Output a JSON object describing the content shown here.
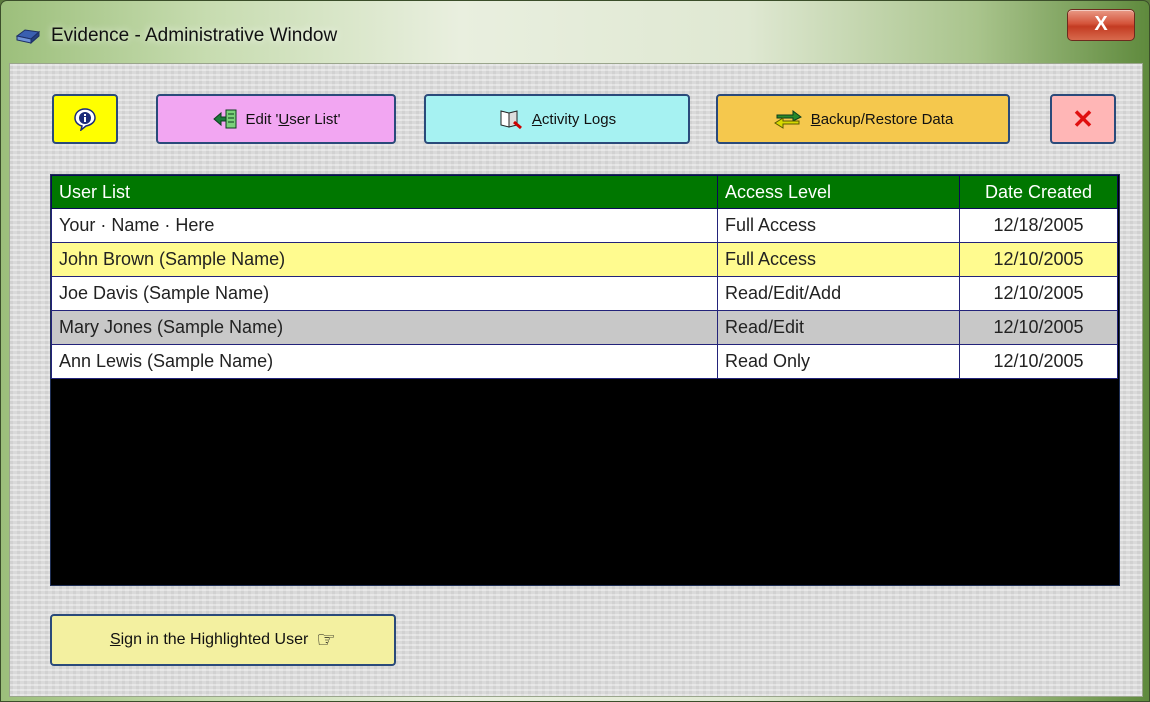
{
  "window": {
    "title": "Evidence - Administrative Window",
    "close_glyph": "X"
  },
  "toolbar": {
    "info_icon": "info-icon",
    "edit_label_pre": "Edit '",
    "edit_label_u": "U",
    "edit_label_post": "ser List'",
    "logs_label_u": "A",
    "logs_label_post": "ctivity Logs",
    "backup_label_u": "B",
    "backup_label_post": "ackup/Restore Data",
    "close_glyph": "✕"
  },
  "grid": {
    "headers": [
      "User List",
      "Access Level",
      "Date Created"
    ],
    "rows": [
      {
        "name": "Your · Name · Here",
        "access": "Full Access",
        "date": "12/18/2005"
      },
      {
        "name": "John Brown (Sample Name)",
        "access": "Full Access",
        "date": "12/10/2005"
      },
      {
        "name": "Joe Davis (Sample Name)",
        "access": "Read/Edit/Add",
        "date": "12/10/2005"
      },
      {
        "name": "Mary Jones (Sample Name)",
        "access": "Read/Edit",
        "date": "12/10/2005"
      },
      {
        "name": "Ann Lewis (Sample Name)",
        "access": "Read Only",
        "date": "12/10/2005"
      }
    ],
    "highlighted_row": 1
  },
  "footer": {
    "sign_in_u": "S",
    "sign_in_post": "ign in the Highlighted User",
    "pointer_glyph": "☞"
  },
  "colors": {
    "header_green": "#007700",
    "highlight_yellow": "#fffb8f",
    "selected_gray": "#c8c8c8"
  }
}
